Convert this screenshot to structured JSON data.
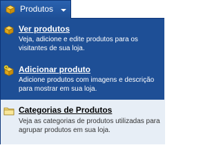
{
  "menu": {
    "label": "Produtos",
    "icon": "box-icon"
  },
  "items": [
    {
      "title": "Ver produtos",
      "description": "Veja, adicione e edite produtos para os visitantes de sua loja.",
      "icon": "box-icon"
    },
    {
      "title": "Adicionar produto",
      "description": "Adicione produtos com imagens e descrição para mostrar em sua loja.",
      "icon": "box-add-icon"
    },
    {
      "title": "Categorias de Produtos",
      "description": "Veja as categorias de produtos utilizadas para agrupar produtos em sua loja.",
      "icon": "folder-icon"
    }
  ],
  "colors": {
    "menu_background": "#1e4f96",
    "highlight_background": "#e7eef6",
    "icon_gold": "#e8b21d"
  }
}
